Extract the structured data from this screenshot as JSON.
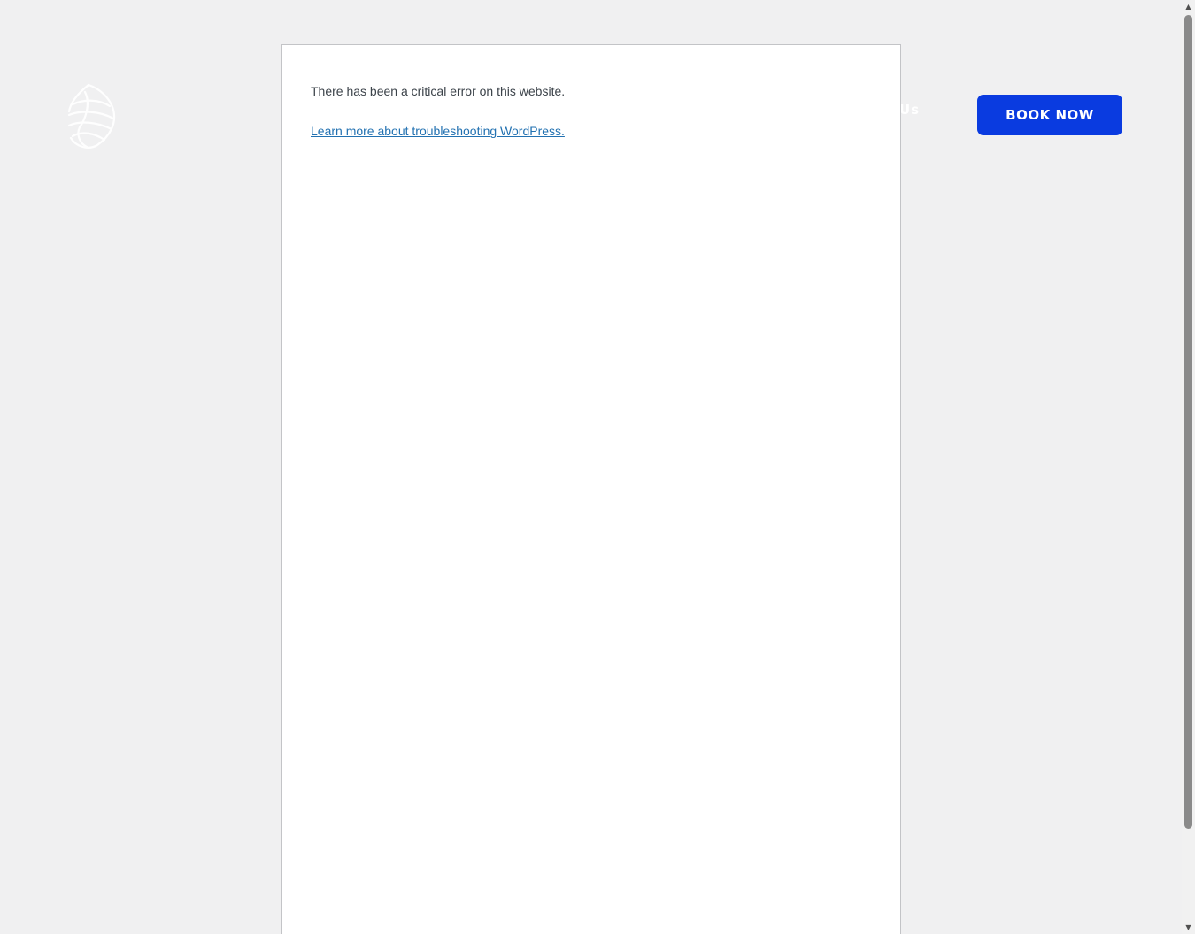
{
  "header": {
    "logo_icon": "shell-logo-icon",
    "nav_faint_text": "Us",
    "book_button_label": "BOOK NOW",
    "book_button_color": "#0a3be0"
  },
  "error": {
    "message": "There has been a critical error on this website.",
    "link_text": "Learn more about troubleshooting WordPress.",
    "link_color": "#2271b1"
  },
  "scrollbar": {
    "up_icon": "arrow-up-icon",
    "down_icon": "arrow-down-icon"
  }
}
